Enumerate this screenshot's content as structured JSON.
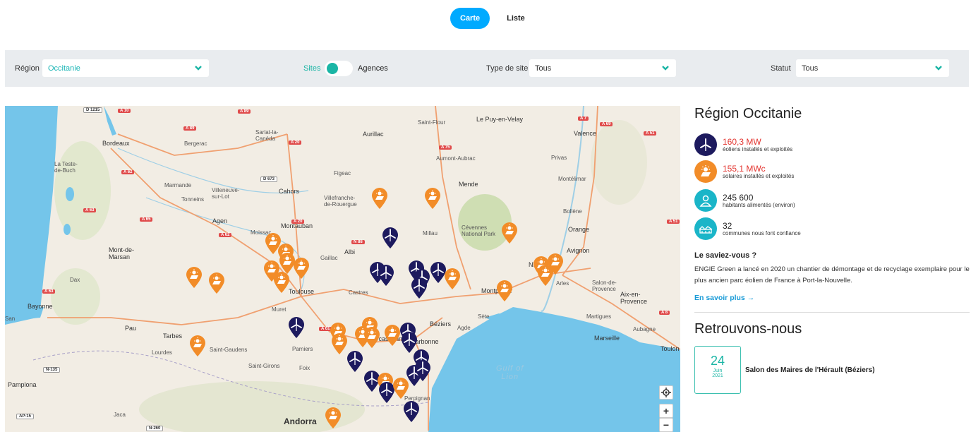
{
  "view_toggle": {
    "map_label": "Carte",
    "list_label": "Liste"
  },
  "filters": {
    "region_label": "Région",
    "region_value": "Occitanie",
    "switch_left": "Sites",
    "switch_right": "Agences",
    "type_label": "Type de site",
    "type_value": "Tous",
    "status_label": "Statut",
    "status_value": "Tous"
  },
  "map": {
    "cities": [
      "Bordeaux",
      "Bergerac",
      "Sarlat-la-Canéda",
      "Aurillac",
      "Saint-Flour",
      "Le Puy-en-Velay",
      "Valence",
      "La Teste-de-Buch",
      "Marmande",
      "Villeneuve-sur-Lot",
      "Tonneins",
      "Cahors",
      "Figeac",
      "Aumont-Aubrac",
      "Mende",
      "Privas",
      "Montélimar",
      "Villefranche-de-Rouergue",
      "Agen",
      "Moissac",
      "Montauban",
      "Gaillac",
      "Albi",
      "Millau",
      "Cévennes National Park",
      "Bollène",
      "Orange",
      "Mont-de-Marsan",
      "Avignon",
      "Dax",
      "Castres",
      "Montpellier",
      "Nîmes",
      "Arles",
      "Salon-de-Provence",
      "Aix-en-Provence",
      "Bayonne",
      "Toulouse",
      "Muret",
      "Béziers",
      "Agde",
      "Sète",
      "Martigues",
      "Pau",
      "Tarbes",
      "Aubagne",
      "Marseille",
      "Toulon",
      "Lourdes",
      "Saint-Gaudens",
      "Pamiers",
      "Carcassonne",
      "Narbonne",
      "Saint-Girons",
      "Foix",
      "Pamplona",
      "Jaca",
      "Andorra",
      "Perpignan",
      "San"
    ],
    "sea_label": "Gulf of Lion",
    "roads": [
      "D 1215",
      "A 10",
      "A 89",
      "A 89",
      "A 7",
      "A 69",
      "A 51",
      "A 20",
      "A 75",
      "D 673",
      "A 62",
      "A 63",
      "A 65",
      "A 20",
      "A 62",
      "N 88",
      "A 51",
      "A 63",
      "A 61",
      "A 9",
      "N-135",
      "AP-15",
      "N-260",
      "N-240"
    ],
    "locate_icon": "crosshair-icon",
    "zoom_in": "+",
    "zoom_out": "−"
  },
  "panel": {
    "title": "Région Occitanie",
    "stats": [
      {
        "icon": "wind-turbine-icon",
        "value": "160,3 MW",
        "desc": "éoliens installés et exploités",
        "color": "#1d1a5e"
      },
      {
        "icon": "solar-panel-icon",
        "value": "155,1 MWc",
        "desc": "solaires installés et exploités",
        "color": "#f28c28"
      },
      {
        "icon": "person-icon",
        "value": "245 600",
        "desc": "habitants alimentés (environ)",
        "color": "#1ab5c8"
      },
      {
        "icon": "houses-icon",
        "value": "32",
        "desc": "communes nous font confiance",
        "color": "#1ab5c8"
      }
    ],
    "did_you_know_title": "Le saviez-vous ?",
    "did_you_know_text": "ENGIE Green a lancé en 2020 un chantier de démontage et de recyclage exemplaire pour le plus ancien parc éolien de France à Port-la-Nouvelle.",
    "more_link": "En savoir plus →",
    "find_us_title": "Retrouvons-nous",
    "event": {
      "day": "24",
      "month": "Juin",
      "year": "2021",
      "title": "Salon des Maires de l'Hérault (Béziers)"
    }
  },
  "colors": {
    "accent_blue": "#00aaff",
    "teal": "#1ab5a5",
    "wind": "#1d1a5e",
    "solar": "#f28c28",
    "sea": "#74c5ea",
    "land": "#f2ede4",
    "red": "#e3342f"
  }
}
